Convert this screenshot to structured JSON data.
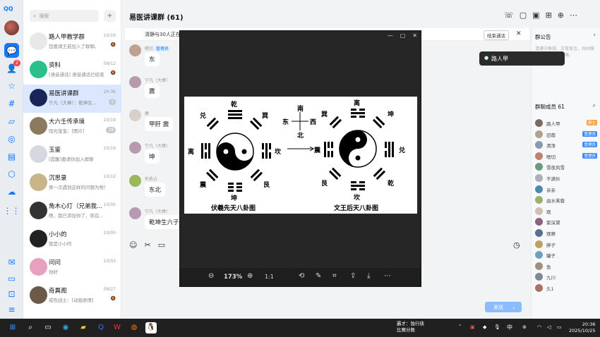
{
  "app": {
    "logo": "QQ"
  },
  "rail": {
    "badge": "2"
  },
  "search": {
    "placeholder": "搜索"
  },
  "conversations": [
    {
      "name": "路人甲教学群",
      "preview": "您邀请王茹加入了群聊。",
      "time": "10/19",
      "meta": "mute"
    },
    {
      "name": "资料",
      "preview": "[语音通话] 语音通话已结束",
      "time": "09/12",
      "meta": "mute"
    },
    {
      "name": "易医讲课群",
      "preview": "宁凡（大棒）：乾坤生...",
      "time": "20:36",
      "count": "1"
    },
    {
      "name": "大六壬传承境",
      "preview": "阳光宝宝：[图片]",
      "time": "10/19",
      "count": "18"
    },
    {
      "name": "玉鉴",
      "preview": "[提醒]邀请你加入群聊",
      "time": "10/19"
    },
    {
      "name": "沉思录",
      "preview": "第一次遇到这样的问题为啥思路",
      "time": "10/12"
    },
    {
      "name": "角木心灯（兄弟我...",
      "preview": "嗯，我已添加你了，现在...",
      "time": "10/05"
    },
    {
      "name": "小小的",
      "preview": "我是小小的",
      "time": "10/05"
    },
    {
      "name": "问问",
      "preview": "你好",
      "time": "10/03"
    },
    {
      "name": "奇異阁",
      "preview": "戒色战士：[动画表情]",
      "time": "09/27",
      "meta": "mute"
    }
  ],
  "chat": {
    "title": "易医讲课群 (61)",
    "call_text": "清静与30人正在",
    "end_call": "结束通话",
    "messages": [
      {
        "name": "嗯切",
        "tag": "管理员",
        "text": "东"
      },
      {
        "name": "宁凡（大棒）",
        "text": "震"
      },
      {
        "name": "唐",
        "text": "甲肝 震"
      },
      {
        "name": "宁凡（大棒）",
        "text": "坤"
      },
      {
        "name": "失依占",
        "text": "东北"
      },
      {
        "name": "宁凡（大棒）",
        "text": "乾坤生六子"
      }
    ],
    "send_label": "发送"
  },
  "right_panel": {
    "announcement_title": "群公告",
    "announcement_text": "请遵守群规，正常发言，共同维护良好的交流环境。",
    "members_title": "群聊成员 61",
    "tooltip": "路人甲",
    "members": [
      {
        "name": "路人甲",
        "tag": "群主",
        "tag_color": "#f7a23b"
      },
      {
        "name": "旧南",
        "tag": "管理员",
        "tag_color": "#3d8bff"
      },
      {
        "name": "清净",
        "tag": "管理员",
        "tag_color": "#3d8bff"
      },
      {
        "name": "嗯切",
        "tag": "管理员",
        "tag_color": "#3d8bff"
      },
      {
        "name": "雪夜风雪"
      },
      {
        "name": "不满伙"
      },
      {
        "name": "亲亲"
      },
      {
        "name": "由水芙蓉"
      },
      {
        "name": "观"
      },
      {
        "name": "紫深黛"
      },
      {
        "name": "观察"
      },
      {
        "name": "胖子"
      },
      {
        "name": "罐子"
      },
      {
        "name": "鱼"
      },
      {
        "name": "九川"
      },
      {
        "name": "久1"
      }
    ]
  },
  "viewer": {
    "zoom": "173%",
    "left_title": "伏羲先天八卦图",
    "right_title": "文王后天八卦图",
    "dir_n": "南",
    "dir_s": "北",
    "dir_e": "东",
    "dir_w": "西",
    "left_labels": {
      "top": "乾",
      "bottom": "坤",
      "left": "离",
      "right": "坎",
      "tl": "兑",
      "tr": "巽",
      "bl": "震",
      "br": "艮"
    },
    "right_labels": {
      "top": "离",
      "bottom": "坎",
      "left": "震",
      "right": "兑",
      "tl": "巽",
      "tr": "坤",
      "bl": "艮",
      "br": "乾"
    }
  },
  "taskbar": {
    "news_title": "霸才：独行侠",
    "news_sub": "比赛分数",
    "ime": "中",
    "time": "20:36",
    "date": "2025/10/25"
  }
}
